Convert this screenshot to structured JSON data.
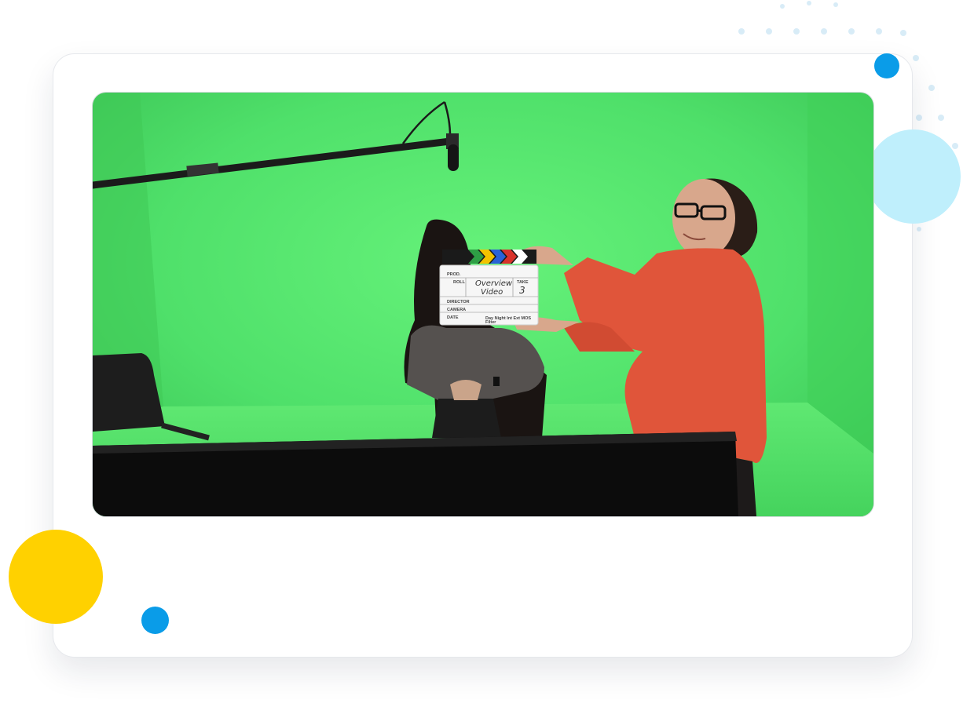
{
  "photo": {
    "subject": "green-screen-video-shoot",
    "clapperboard": {
      "labels": {
        "prod": "PROD.",
        "roll": "ROLL",
        "take_label": "TAKE",
        "director": "DIRECTOR",
        "camera": "CAMERA",
        "date": "DATE",
        "options": "Day  Night  Int  Ext  MOS",
        "filter": "Filter"
      },
      "handwritten_line1": "Overview",
      "handwritten_line2": "Video",
      "take_number": "3",
      "stripe_colors": [
        "#2e9e45",
        "#f2c200",
        "#2a62d6",
        "#d9322b",
        "#ffffff"
      ]
    }
  },
  "decor": {
    "colors": {
      "yellow": "#FFD100",
      "blue": "#0A9CE8",
      "light_blue": "#BFEFFC",
      "green_screen": "#4fe06a"
    }
  }
}
